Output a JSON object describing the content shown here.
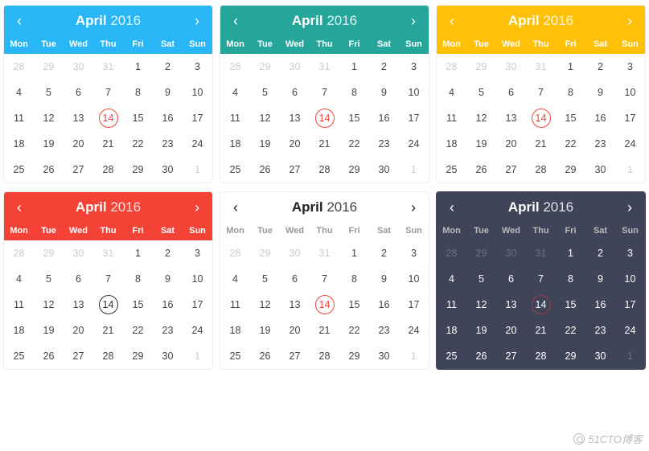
{
  "dow": [
    "Mon",
    "Tue",
    "Wed",
    "Thu",
    "Fri",
    "Sat",
    "Sun"
  ],
  "month_label": "April",
  "year_label": "2016",
  "today": 14,
  "leading_other": [
    28,
    29,
    30,
    31
  ],
  "month_days": 30,
  "trailing_other": [
    1
  ],
  "watermark": "51CTO博客",
  "calendars": [
    {
      "theme": "blue",
      "header_style": "color",
      "dark": false
    },
    {
      "theme": "green",
      "header_style": "color",
      "dark": false
    },
    {
      "theme": "yellow",
      "header_style": "color",
      "dark": false
    },
    {
      "theme": "red",
      "header_style": "color",
      "dark": false
    },
    {
      "theme": "plain",
      "header_style": "plain",
      "dark": false
    },
    {
      "theme": "dark",
      "header_style": "dark",
      "dark": true
    }
  ]
}
